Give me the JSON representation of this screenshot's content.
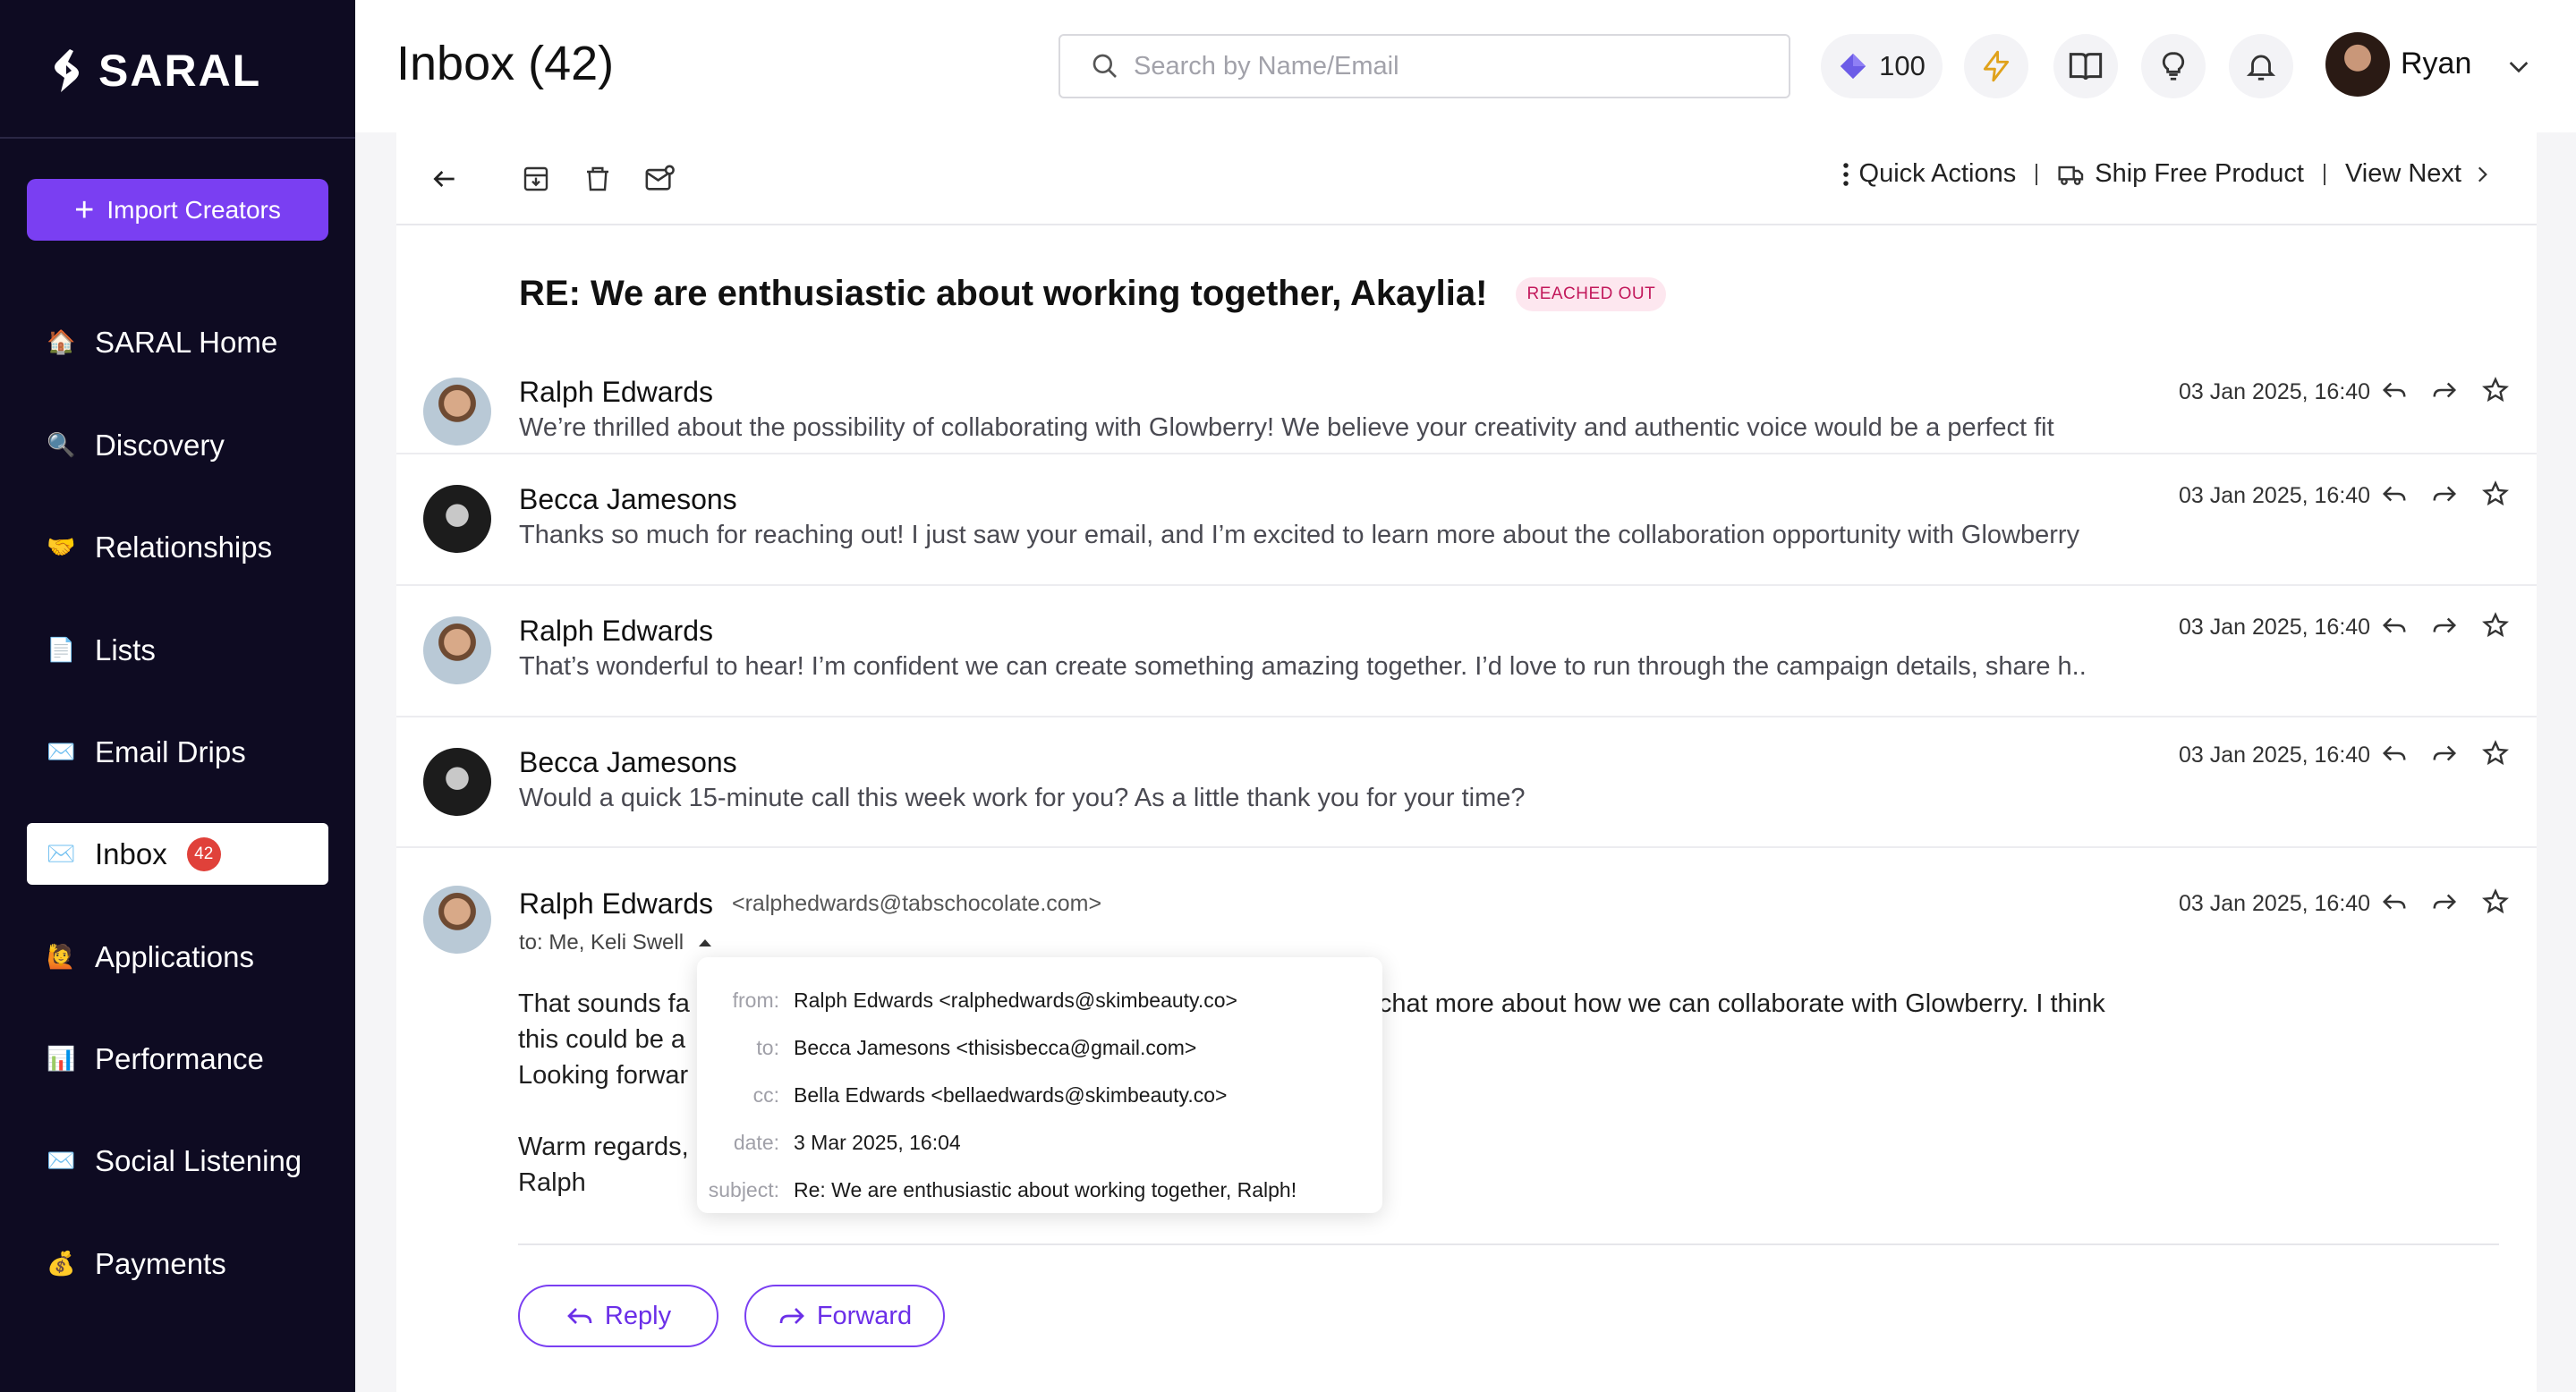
{
  "brand": {
    "name": "SARAL"
  },
  "sidebar": {
    "import_button": "Import Creators",
    "items": [
      {
        "label": "SARAL Home",
        "emoji": "🏠"
      },
      {
        "label": "Discovery",
        "emoji": "🔍"
      },
      {
        "label": "Relationships",
        "emoji": "🤝"
      },
      {
        "label": "Lists",
        "emoji": "📄"
      },
      {
        "label": "Email Drips",
        "emoji": "✉️"
      },
      {
        "label": "Inbox",
        "emoji": "✉️",
        "badge": "42",
        "active": true
      },
      {
        "label": "Applications",
        "emoji": "🙋"
      },
      {
        "label": "Performance",
        "emoji": "📊"
      },
      {
        "label": "Social Listening",
        "emoji": "✉️"
      },
      {
        "label": "Payments",
        "emoji": "💰"
      }
    ]
  },
  "header": {
    "title": "Inbox (42)",
    "search_placeholder": "Search by Name/Email",
    "credits": "100",
    "user_name": "Ryan"
  },
  "toolbar": {
    "quick_actions": "Quick Actions",
    "ship_free_product": "Ship Free Product",
    "view_next": "View Next"
  },
  "thread": {
    "subject": "RE: We are enthusiastic about working together, Akaylia!",
    "status": "REACHED OUT",
    "messages": [
      {
        "sender": "Ralph Edwards",
        "preview": "We’re thrilled about the possibility of collaborating with Glowberry! We believe your creativity and authentic voice would be a perfect fit",
        "time": "03 Jan 2025, 16:40"
      },
      {
        "sender": "Becca Jamesons",
        "preview": "Thanks so much for reaching out! I just saw your email, and I’m excited to learn more about the collaboration opportunity with Glowberry",
        "time": "03 Jan 2025, 16:40"
      },
      {
        "sender": "Ralph Edwards",
        "preview": "That’s wonderful to hear! I’m confident we can create something amazing together. I’d love to run through the campaign details, share h..",
        "time": "03 Jan 2025, 16:40"
      },
      {
        "sender": "Becca Jamesons",
        "preview": "Would a quick 15-minute call this week work for you? As a little thank you for your time?",
        "time": "03 Jan 2025, 16:40"
      }
    ],
    "expanded": {
      "sender": "Ralph Edwards",
      "email": "<ralphedwards@tabschocolate.com>",
      "time": "03 Jan 2025, 16:40",
      "to_line": "to: Me, Keli Swell",
      "body": {
        "line1_start": "That sounds fa",
        "line1_end": "chat more about how we can collaborate with Glowberry. I think",
        "line2": "this could be a",
        "line3": "Looking forwar",
        "signoff": "Warm regards,",
        "signature": "Ralph"
      },
      "reply_label": "Reply",
      "forward_label": "Forward"
    }
  },
  "details_popover": {
    "from_key": "from:",
    "from_name": "Ralph Edwards",
    "from_email": "<ralphedwards@skimbeauty.co>",
    "to_key": "to:",
    "to_value": "Becca Jamesons <thisisbecca@gmail.com>",
    "cc_key": "cc:",
    "cc_value": "Bella Edwards <bellaedwards@skimbeauty.co>",
    "date_key": "date:",
    "date_value": "3 Mar 2025, 16:04",
    "subject_key": "subject:",
    "subject_value": "Re: We are enthusiastic about working together, Ralph!"
  },
  "colors": {
    "accent": "#7a3ff2",
    "sidebar_bg": "#0e0b22",
    "badge": "#e0413a",
    "status_pill_bg": "#fde7ef"
  }
}
